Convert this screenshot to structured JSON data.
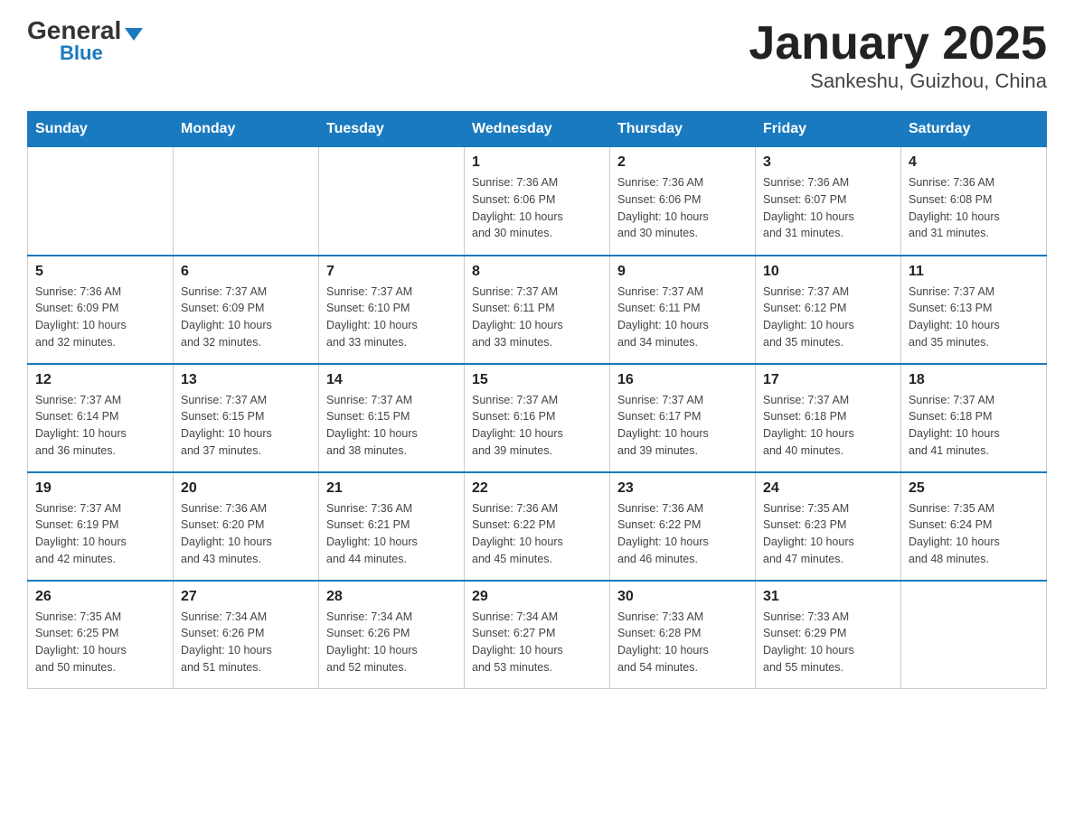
{
  "logo": {
    "general": "General",
    "blue": "Blue",
    "triangle": "▼"
  },
  "title": "January 2025",
  "subtitle": "Sankeshu, Guizhou, China",
  "days_of_week": [
    "Sunday",
    "Monday",
    "Tuesday",
    "Wednesday",
    "Thursday",
    "Friday",
    "Saturday"
  ],
  "weeks": [
    [
      {
        "num": "",
        "info": ""
      },
      {
        "num": "",
        "info": ""
      },
      {
        "num": "",
        "info": ""
      },
      {
        "num": "1",
        "info": "Sunrise: 7:36 AM\nSunset: 6:06 PM\nDaylight: 10 hours\nand 30 minutes."
      },
      {
        "num": "2",
        "info": "Sunrise: 7:36 AM\nSunset: 6:06 PM\nDaylight: 10 hours\nand 30 minutes."
      },
      {
        "num": "3",
        "info": "Sunrise: 7:36 AM\nSunset: 6:07 PM\nDaylight: 10 hours\nand 31 minutes."
      },
      {
        "num": "4",
        "info": "Sunrise: 7:36 AM\nSunset: 6:08 PM\nDaylight: 10 hours\nand 31 minutes."
      }
    ],
    [
      {
        "num": "5",
        "info": "Sunrise: 7:36 AM\nSunset: 6:09 PM\nDaylight: 10 hours\nand 32 minutes."
      },
      {
        "num": "6",
        "info": "Sunrise: 7:37 AM\nSunset: 6:09 PM\nDaylight: 10 hours\nand 32 minutes."
      },
      {
        "num": "7",
        "info": "Sunrise: 7:37 AM\nSunset: 6:10 PM\nDaylight: 10 hours\nand 33 minutes."
      },
      {
        "num": "8",
        "info": "Sunrise: 7:37 AM\nSunset: 6:11 PM\nDaylight: 10 hours\nand 33 minutes."
      },
      {
        "num": "9",
        "info": "Sunrise: 7:37 AM\nSunset: 6:11 PM\nDaylight: 10 hours\nand 34 minutes."
      },
      {
        "num": "10",
        "info": "Sunrise: 7:37 AM\nSunset: 6:12 PM\nDaylight: 10 hours\nand 35 minutes."
      },
      {
        "num": "11",
        "info": "Sunrise: 7:37 AM\nSunset: 6:13 PM\nDaylight: 10 hours\nand 35 minutes."
      }
    ],
    [
      {
        "num": "12",
        "info": "Sunrise: 7:37 AM\nSunset: 6:14 PM\nDaylight: 10 hours\nand 36 minutes."
      },
      {
        "num": "13",
        "info": "Sunrise: 7:37 AM\nSunset: 6:15 PM\nDaylight: 10 hours\nand 37 minutes."
      },
      {
        "num": "14",
        "info": "Sunrise: 7:37 AM\nSunset: 6:15 PM\nDaylight: 10 hours\nand 38 minutes."
      },
      {
        "num": "15",
        "info": "Sunrise: 7:37 AM\nSunset: 6:16 PM\nDaylight: 10 hours\nand 39 minutes."
      },
      {
        "num": "16",
        "info": "Sunrise: 7:37 AM\nSunset: 6:17 PM\nDaylight: 10 hours\nand 39 minutes."
      },
      {
        "num": "17",
        "info": "Sunrise: 7:37 AM\nSunset: 6:18 PM\nDaylight: 10 hours\nand 40 minutes."
      },
      {
        "num": "18",
        "info": "Sunrise: 7:37 AM\nSunset: 6:18 PM\nDaylight: 10 hours\nand 41 minutes."
      }
    ],
    [
      {
        "num": "19",
        "info": "Sunrise: 7:37 AM\nSunset: 6:19 PM\nDaylight: 10 hours\nand 42 minutes."
      },
      {
        "num": "20",
        "info": "Sunrise: 7:36 AM\nSunset: 6:20 PM\nDaylight: 10 hours\nand 43 minutes."
      },
      {
        "num": "21",
        "info": "Sunrise: 7:36 AM\nSunset: 6:21 PM\nDaylight: 10 hours\nand 44 minutes."
      },
      {
        "num": "22",
        "info": "Sunrise: 7:36 AM\nSunset: 6:22 PM\nDaylight: 10 hours\nand 45 minutes."
      },
      {
        "num": "23",
        "info": "Sunrise: 7:36 AM\nSunset: 6:22 PM\nDaylight: 10 hours\nand 46 minutes."
      },
      {
        "num": "24",
        "info": "Sunrise: 7:35 AM\nSunset: 6:23 PM\nDaylight: 10 hours\nand 47 minutes."
      },
      {
        "num": "25",
        "info": "Sunrise: 7:35 AM\nSunset: 6:24 PM\nDaylight: 10 hours\nand 48 minutes."
      }
    ],
    [
      {
        "num": "26",
        "info": "Sunrise: 7:35 AM\nSunset: 6:25 PM\nDaylight: 10 hours\nand 50 minutes."
      },
      {
        "num": "27",
        "info": "Sunrise: 7:34 AM\nSunset: 6:26 PM\nDaylight: 10 hours\nand 51 minutes."
      },
      {
        "num": "28",
        "info": "Sunrise: 7:34 AM\nSunset: 6:26 PM\nDaylight: 10 hours\nand 52 minutes."
      },
      {
        "num": "29",
        "info": "Sunrise: 7:34 AM\nSunset: 6:27 PM\nDaylight: 10 hours\nand 53 minutes."
      },
      {
        "num": "30",
        "info": "Sunrise: 7:33 AM\nSunset: 6:28 PM\nDaylight: 10 hours\nand 54 minutes."
      },
      {
        "num": "31",
        "info": "Sunrise: 7:33 AM\nSunset: 6:29 PM\nDaylight: 10 hours\nand 55 minutes."
      },
      {
        "num": "",
        "info": ""
      }
    ]
  ]
}
